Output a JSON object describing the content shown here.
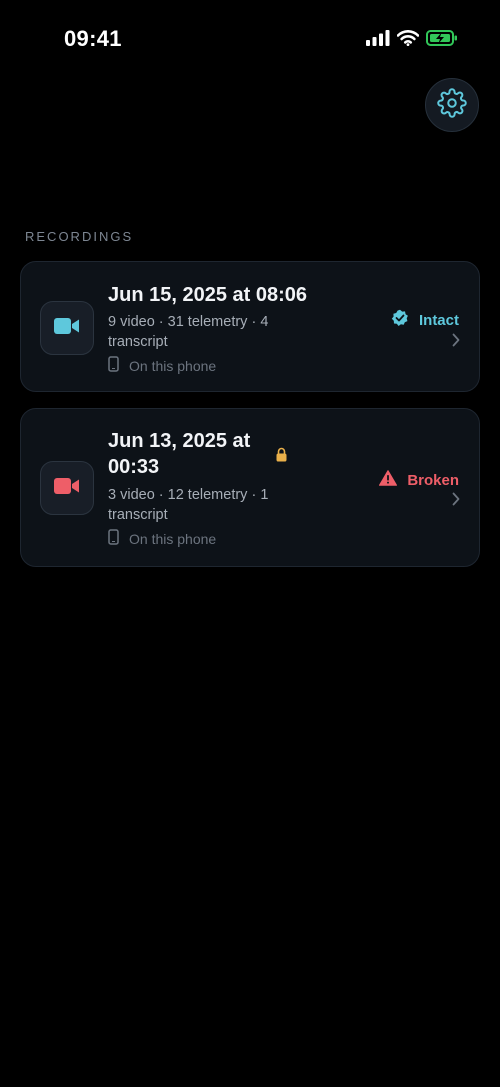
{
  "status_bar": {
    "time": "09:41",
    "icons": [
      "signal-icon",
      "wifi-icon",
      "battery-charging-icon"
    ]
  },
  "header": {
    "settings_icon": "gear-icon"
  },
  "section": {
    "title": "RECORDINGS"
  },
  "recordings": [
    {
      "title": "Jun 15, 2025 at 08:06",
      "meta": "9 video · 31 telemetry · 4 transcript",
      "location": "On this phone",
      "status": "Intact",
      "status_icon": "verified-badge-icon",
      "locked": false,
      "accent_color": "#5ec8dc"
    },
    {
      "title": "Jun 13, 2025 at 00:33",
      "meta": "3 video · 12 telemetry · 1 transcript",
      "location": "On this phone",
      "status": "Broken",
      "status_icon": "warning-icon",
      "locked": true,
      "accent_color": "#ee5e68"
    }
  ],
  "colors": {
    "background": "#000000",
    "card": "#0d1218",
    "intact": "#5ec8dc",
    "broken": "#ee5e68",
    "lock": "#e9b04a"
  }
}
